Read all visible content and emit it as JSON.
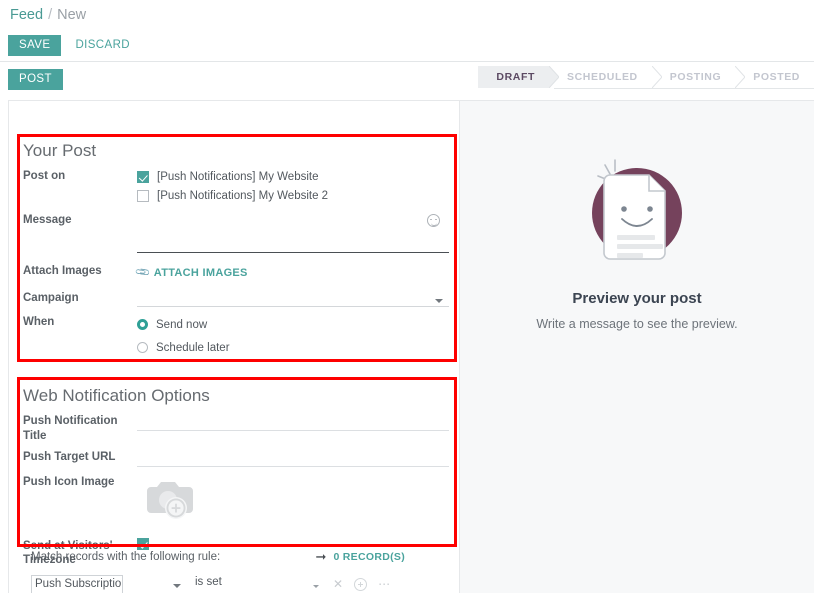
{
  "breadcrumb": {
    "root": "Feed",
    "separator": "/",
    "current": "New"
  },
  "toolbar": {
    "save_label": "SAVE",
    "discard_label": "DISCARD",
    "post_label": "POST"
  },
  "statusbar": {
    "stages": [
      {
        "label": "DRAFT",
        "active": true
      },
      {
        "label": "SCHEDULED",
        "active": false
      },
      {
        "label": "POSTING",
        "active": false
      },
      {
        "label": "POSTED",
        "active": false
      }
    ]
  },
  "your_post": {
    "title": "Your Post",
    "post_on": {
      "label": "Post on",
      "options": [
        {
          "label": "[Push Notifications] My Website",
          "checked": true
        },
        {
          "label": "[Push Notifications] My Website 2",
          "checked": false
        }
      ]
    },
    "message": {
      "label": "Message",
      "value": "",
      "placeholder": "",
      "emoji_icon": "smiley-icon"
    },
    "attach_images": {
      "label": "Attach Images",
      "link": "ATTACH IMAGES",
      "icon": "paperclip-icon"
    },
    "campaign": {
      "label": "Campaign",
      "value": "",
      "placeholder": ""
    },
    "when": {
      "label": "When",
      "options": [
        {
          "label": "Send now",
          "selected": true
        },
        {
          "label": "Schedule later",
          "selected": false
        }
      ]
    }
  },
  "web_notification_options": {
    "title": "Web Notification Options",
    "push_title": {
      "label": "Push Notification Title",
      "value": "",
      "placeholder": ""
    },
    "push_target_url": {
      "label": "Push Target URL",
      "value": "",
      "placeholder": ""
    },
    "push_icon_image": {
      "label": "Push Icon Image",
      "icon": "camera-add-icon"
    },
    "visitors_timezone": {
      "label": "Send at Visitors' Timezone",
      "checked": true
    }
  },
  "domain_rule": {
    "heading": "Match records with the following rule:",
    "arrow_icon": "arrow-right-icon",
    "records_label": "0 RECORD(S)",
    "field_value": "Push Subscription",
    "operator_value": "is set",
    "delete_icon": "close-icon",
    "add_icon": "plus-circle-icon",
    "more_icon": "ellipsis-icon"
  },
  "preview": {
    "illustration": "document-smiley-icon",
    "title": "Preview your post",
    "subtitle": "Write a message to see the preview."
  },
  "colors": {
    "accent_teal": "#4aa39d",
    "highlight_red": "#fe0000",
    "purple_circle": "#75425c",
    "status_active_bg": "#eceef0",
    "panel_bg": "#f7f8f9"
  }
}
